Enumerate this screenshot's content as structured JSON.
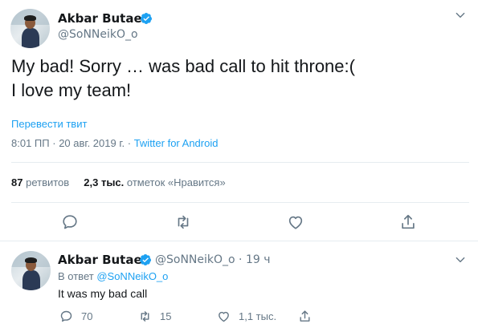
{
  "tweet": {
    "author_name": "Akbar Butaev",
    "author_handle": "@SoNNeikO_o",
    "text_line1": "My bad! Sorry … was bad call to hit throne:(",
    "text_line2": "I love my team!",
    "translate_label": "Перевести твит",
    "time": "8:01 ПП",
    "date": "20 авг. 2019 г.",
    "separator": "·",
    "source": "Twitter for Android",
    "retweets_count": "87",
    "retweets_label": "ретвитов",
    "likes_count": "2,3 тыс.",
    "likes_label": "отметок «Нравится»"
  },
  "reply": {
    "author_name": "Akbar Butaev",
    "author_handle": "@SoNNeikO_o",
    "separator": "·",
    "time_ago": "19 ч",
    "reply_prefix": "В ответ",
    "reply_to": "@SoNNeikO_o",
    "text": "It was my bad call",
    "replies_count": "70",
    "retweets_count": "15",
    "likes_count": "1,1 тыс."
  },
  "icons": {
    "verified": "verified-badge-icon",
    "chevron": "chevron-down-icon",
    "reply": "reply-icon",
    "retweet": "retweet-icon",
    "like": "heart-icon",
    "share": "share-icon"
  },
  "colors": {
    "accent": "#1da1f2",
    "secondary_text": "#657786",
    "primary_text": "#14171a",
    "divider": "#e6ecf0"
  }
}
